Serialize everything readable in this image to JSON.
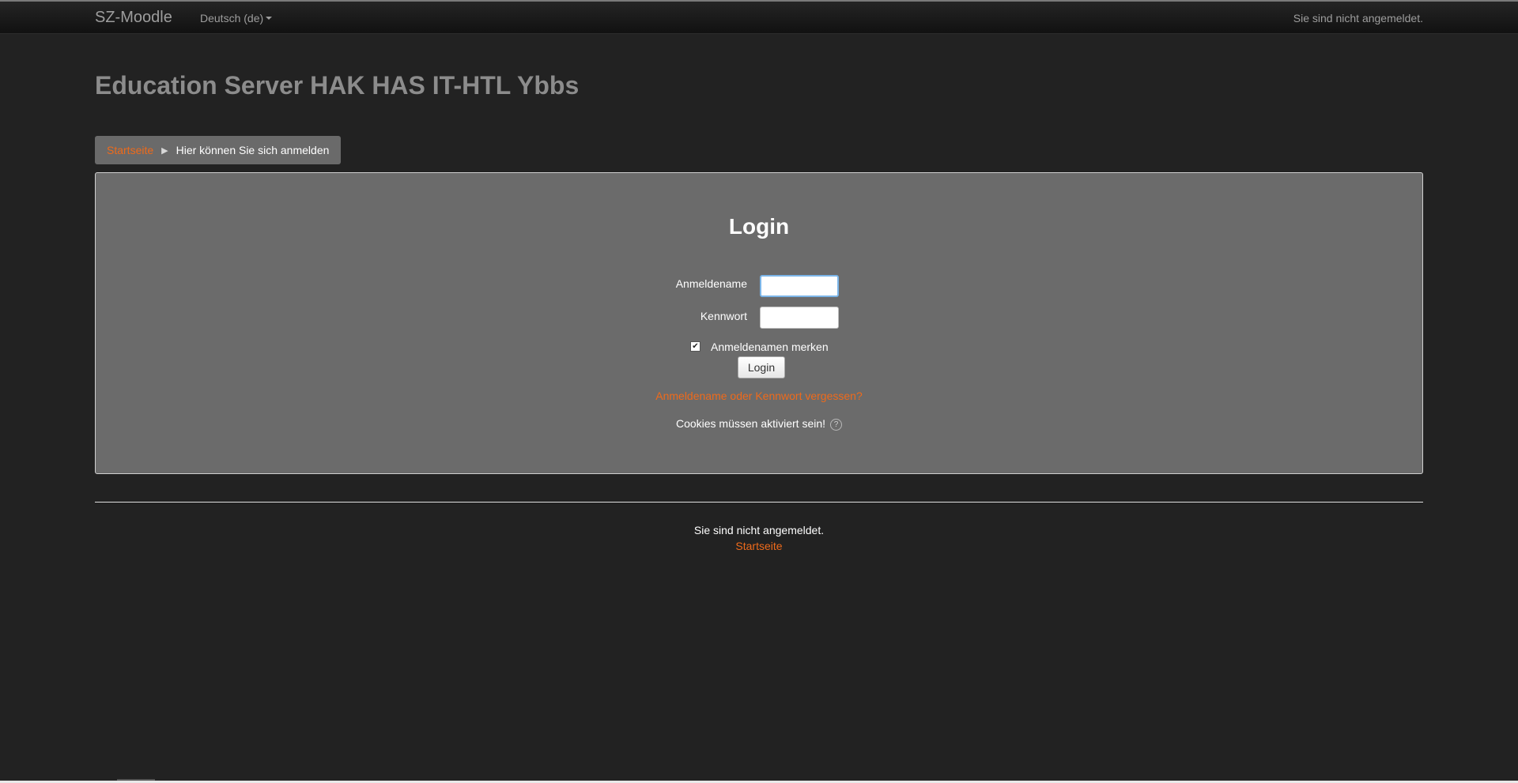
{
  "navbar": {
    "brand": "SZ-Moodle",
    "language": "Deutsch (de)",
    "status": "Sie sind nicht angemeldet."
  },
  "header": {
    "title": "Education Server HAK HAS IT-HTL Ybbs"
  },
  "breadcrumb": {
    "home": "Startseite",
    "current": "Hier können Sie sich anmelden"
  },
  "login": {
    "title": "Login",
    "username_label": "Anmeldename",
    "username_value": "",
    "password_label": "Kennwort",
    "password_value": "",
    "remember_label": "Anmeldenamen merken",
    "remember_checked": true,
    "button_label": "Login",
    "forgot_link": "Anmeldename oder Kennwort vergessen?",
    "cookies_notice": "Cookies müssen aktiviert sein!",
    "help_icon": "help-icon"
  },
  "footer": {
    "status": "Sie sind nicht angemeldet.",
    "home_link": "Startseite"
  },
  "colors": {
    "background": "#222222",
    "panel": "#6b6b6b",
    "accent": "#ee6a1b",
    "title": "#8c8c8c"
  }
}
